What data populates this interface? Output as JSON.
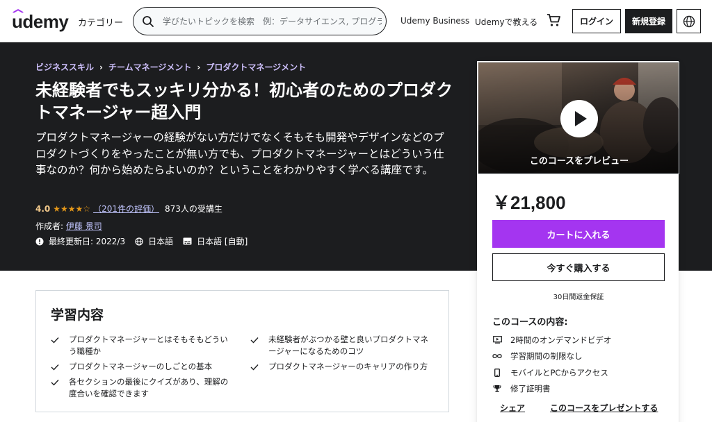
{
  "header": {
    "logo_text": "udemy",
    "category_label": "カテゴリー",
    "search_placeholder": "学びたいトピックを検索　例：データサイエンス, プログラミング",
    "business_link": "Udemy Business",
    "teach_link": "Udemyで教える",
    "login_label": "ログイン",
    "signup_label": "新規登録",
    "icons": [
      "search-icon",
      "cart-icon",
      "globe-icon"
    ]
  },
  "hero": {
    "breadcrumbs": [
      "ビジネススキル",
      "チームマネージメント",
      "プロダクトマネージメント"
    ],
    "title": "未経験者でもスッキリ分かる！初心者のためのプロダクトマネージャー超入門",
    "subtitle": "プロダクトマネージャーの経験がない方だけでなくそもそも開発やデザインなどのプロダクトづくりをやったことが無い方でも、プロダクトマネージャーとはどういう仕事なのか？何から始めたらよいのか？ということをわかりやすく学べる講座です。",
    "rating_value": "4.0",
    "rating_stars": "★★★★☆",
    "rating_fraction": 0.8,
    "review_count": "（201件の評価）",
    "students": "873人の受講生",
    "author_label": "作成者:",
    "author_name": "伊藤 景司",
    "updated": "最終更新日: 2022/3",
    "language": "日本語",
    "captions": "日本語 [自動]"
  },
  "sidebar": {
    "preview_label": "このコースをプレビュー",
    "price": "￥21,800",
    "add_to_cart": "カートに入れる",
    "buy_now": "今すぐ購入する",
    "guarantee": "30日間返金保証",
    "includes_heading": "このコースの内容:",
    "includes": [
      {
        "icon": "video-icon",
        "label": "2時間のオンデマンドビデオ"
      },
      {
        "icon": "infinity-icon",
        "label": "学習期間の制限なし"
      },
      {
        "icon": "mobile-icon",
        "label": "モバイルとPCからアクセス"
      },
      {
        "icon": "trophy-icon",
        "label": "修了証明書"
      }
    ],
    "share_label": "シェア",
    "gift_label": "このコースをプレゼントする"
  },
  "learn": {
    "heading": "学習内容",
    "items_left": [
      "プロダクトマネージャーとはそもそもどういう職種か",
      "プロダクトマネージャーのしごとの基本",
      "各セクションの最後にクイズがあり、理解の度合いを確認できます"
    ],
    "items_right": [
      "未経験者がぶつかる壁と良いプロダクトマネージャーになるためのコツ",
      "プロダクトマネージャーのキャリアの作り方"
    ]
  },
  "colors": {
    "brand_purple": "#a435f0",
    "hero_bg": "#1c1d1f",
    "breadcrumb": "#cec0fc",
    "star": "#e59819"
  }
}
